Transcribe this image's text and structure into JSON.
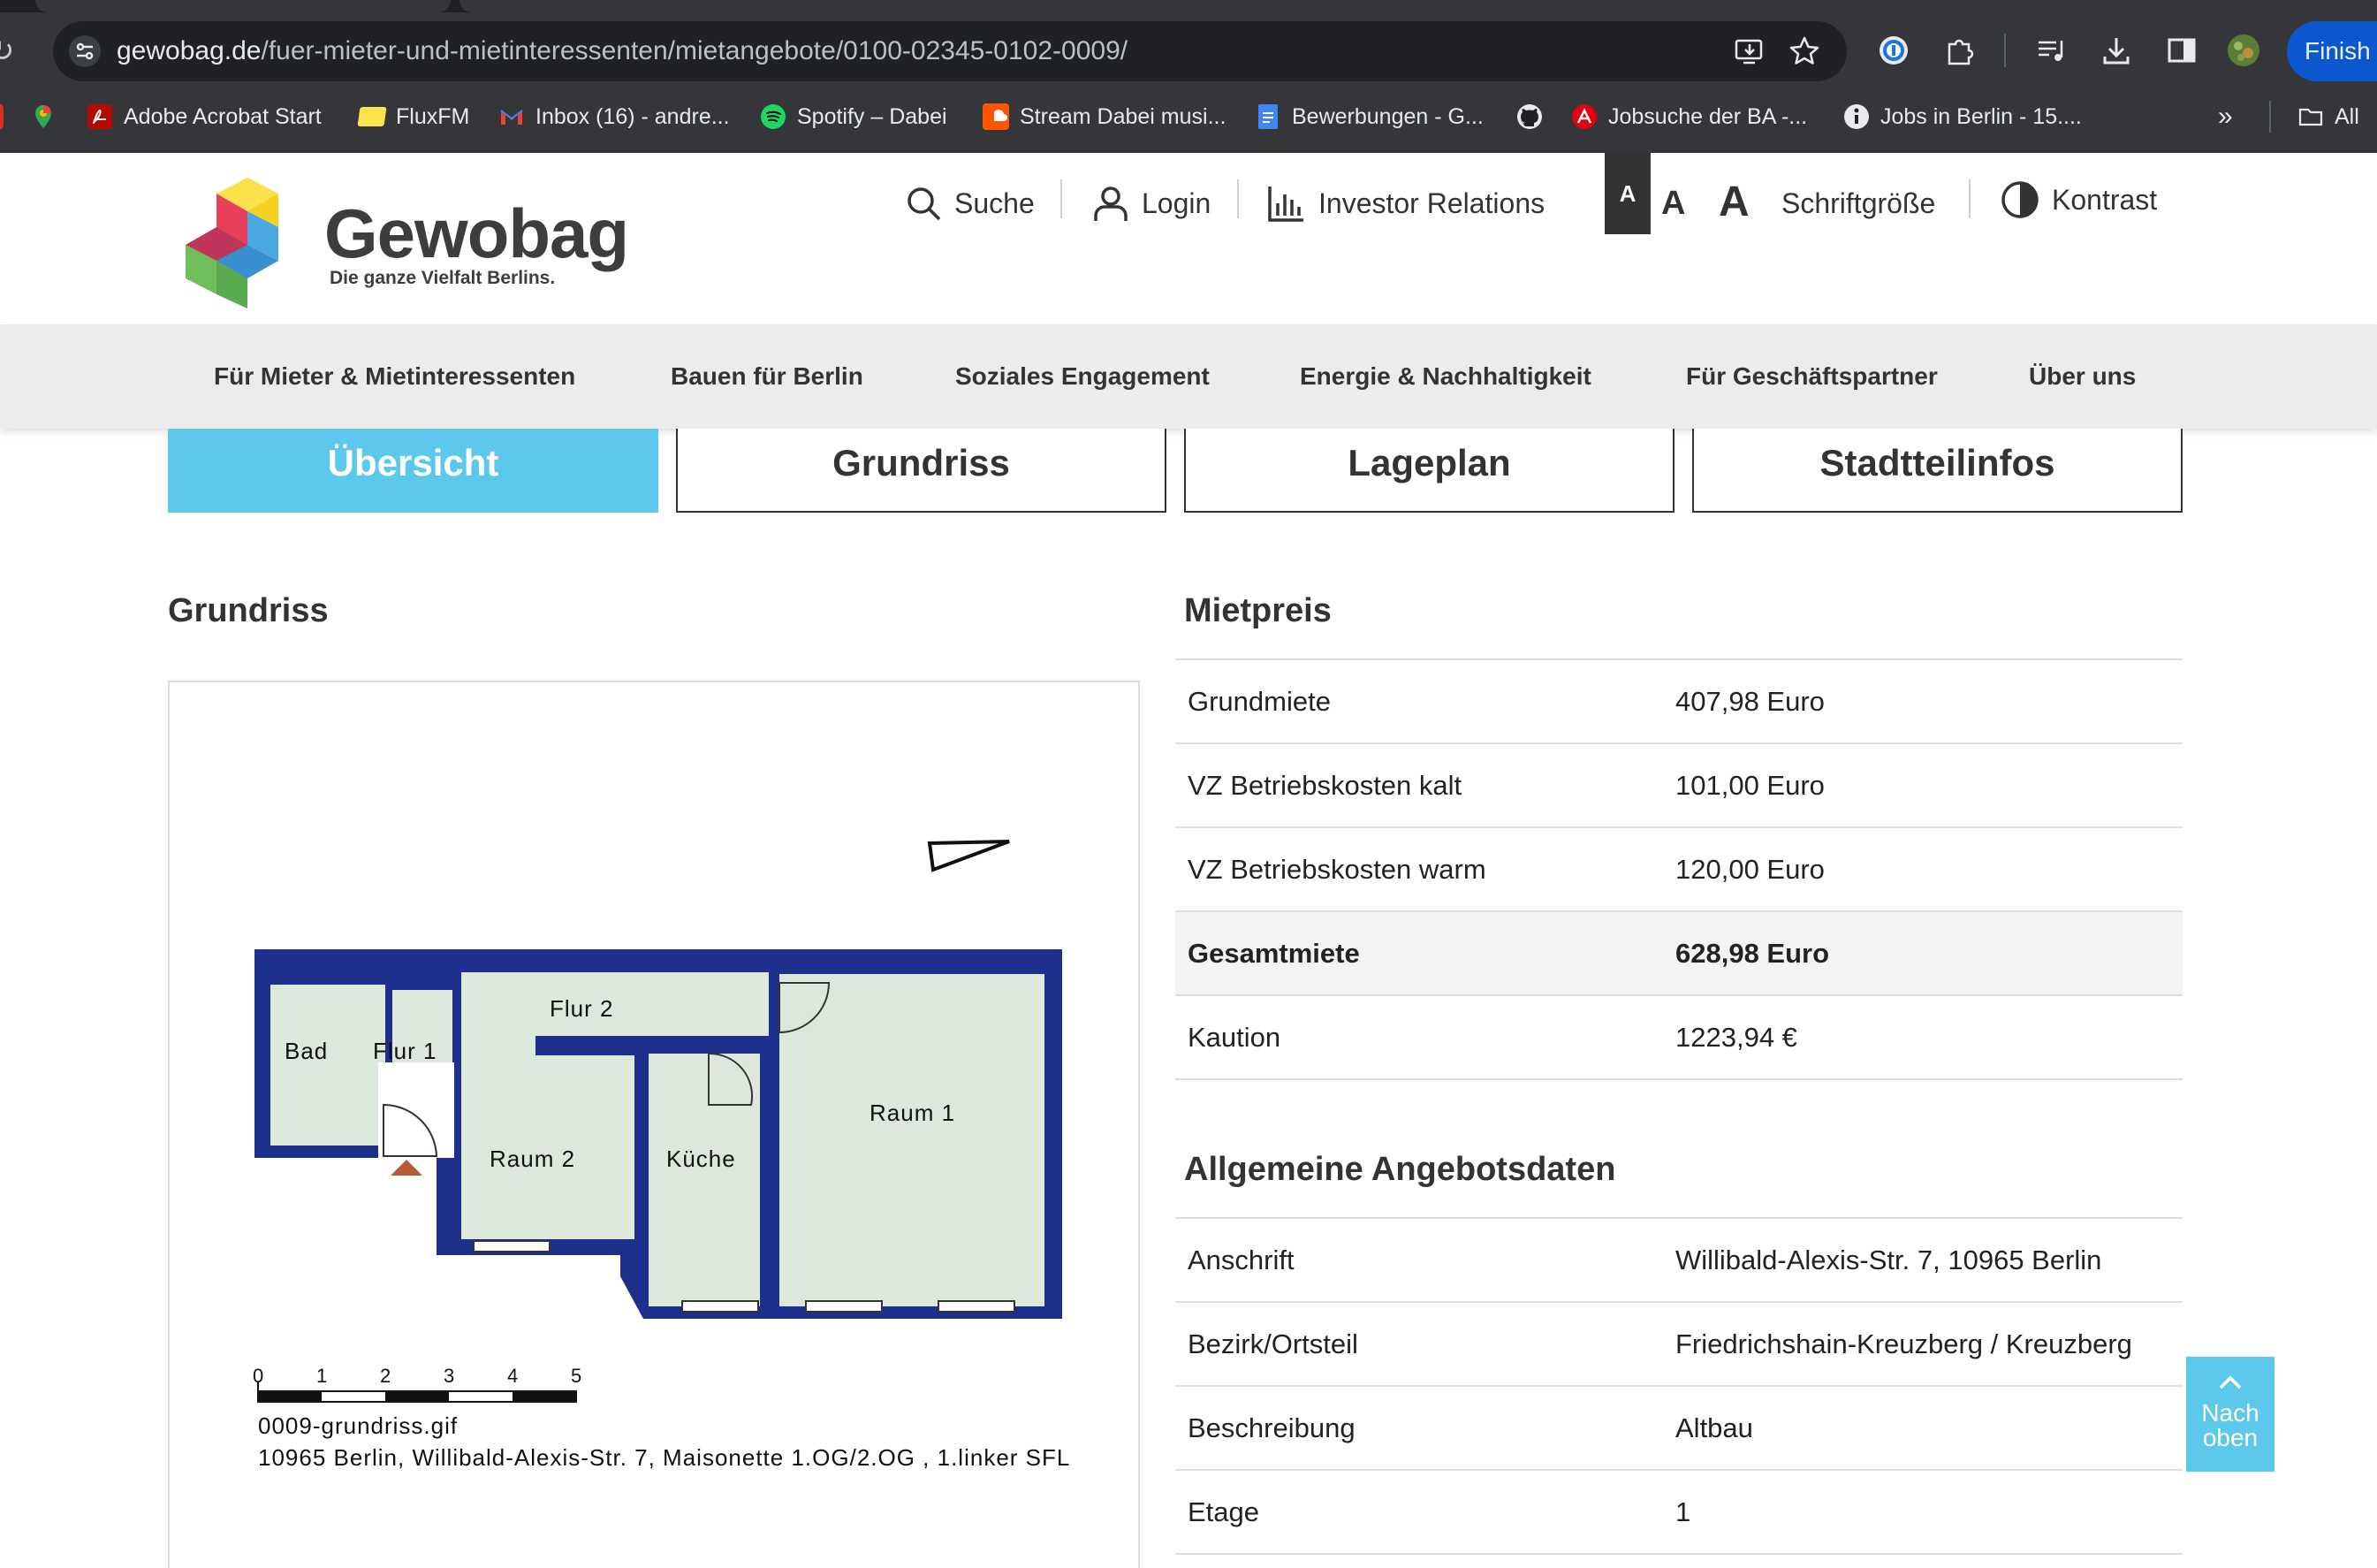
{
  "browser": {
    "url_host": "gewobag.de",
    "url_path": "/fuer-mieter-und-mietinteressenten/mietangebote/0100-02345-0102-0009/",
    "finish_label": "Finish u",
    "bookmarks": [
      {
        "label": "",
        "icon": "maps-icon"
      },
      {
        "label": "Adobe Acrobat Start",
        "icon": "acrobat-icon"
      },
      {
        "label": "FluxFM",
        "icon": "flux-icon"
      },
      {
        "label": "Inbox (16) - andre...",
        "icon": "gmail-icon"
      },
      {
        "label": "Spotify – Dabei",
        "icon": "spotify-icon"
      },
      {
        "label": "Stream Dabei musi...",
        "icon": "soundcloud-icon"
      },
      {
        "label": "Bewerbungen - G...",
        "icon": "docs-icon"
      },
      {
        "label": "",
        "icon": "github-icon"
      },
      {
        "label": "Jobsuche der BA -...",
        "icon": "ba-icon"
      },
      {
        "label": "Jobs in Berlin - 15....",
        "icon": "info-icon"
      }
    ],
    "more_label": "»",
    "all_bookmarks_label": "All"
  },
  "header": {
    "brand": "Gewobag",
    "tagline": "Die ganze Vielfalt Berlins.",
    "search_label": "Suche",
    "login_label": "Login",
    "investor_label": "Investor Relations",
    "font_small": "A",
    "font_medium": "A",
    "font_large": "A",
    "font_size_label": "Schriftgröße",
    "contrast_label": "Kontrast"
  },
  "nav": [
    "Für Mieter & Mietinteressenten",
    "Bauen für Berlin",
    "Soziales Engagement",
    "Energie & Nachhaltigkeit",
    "Für Geschäftspartner",
    "Über uns"
  ],
  "tabs": [
    "Übersicht",
    "Grundriss",
    "Lageplan",
    "Stadtteilinfos"
  ],
  "floorplan": {
    "heading": "Grundriss",
    "rooms": [
      "Bad",
      "Flur 1",
      "Flur 2",
      "Raum 2",
      "Küche",
      "Raum 1"
    ],
    "scale": [
      "0",
      "1",
      "2",
      "3",
      "4",
      "5"
    ],
    "filename": "0009-grundriss.gif",
    "caption": "10965 Berlin, Willibald-Alexis-Str. 7, Maisonette 1.OG/2.OG , 1.linker SFL"
  },
  "mietpreis": {
    "heading": "Mietpreis",
    "rows": [
      {
        "key": "Grundmiete",
        "value": "407,98 Euro"
      },
      {
        "key": "VZ Betriebskosten kalt",
        "value": "101,00 Euro"
      },
      {
        "key": "VZ Betriebskosten warm",
        "value": "120,00 Euro"
      },
      {
        "key": "Gesamtmiete",
        "value": "628,98 Euro"
      },
      {
        "key": "Kaution",
        "value": "1223,94 €"
      }
    ]
  },
  "angebot": {
    "heading": "Allgemeine Angebotsdaten",
    "rows": [
      {
        "key": "Anschrift",
        "value": "Willibald-Alexis-Str. 7, 10965 Berlin"
      },
      {
        "key": "Bezirk/Ortsteil",
        "value": "Friedrichshain-Kreuzberg / Kreuzberg"
      },
      {
        "key": "Beschreibung",
        "value": "Altbau"
      },
      {
        "key": "Etage",
        "value": "1"
      }
    ]
  },
  "back_to_top": {
    "line1": "Nach",
    "line2": "oben"
  },
  "colors": {
    "accent": "#5bc8ec",
    "plan_wall": "#1f2f8c",
    "plan_room": "#dde8dd"
  }
}
